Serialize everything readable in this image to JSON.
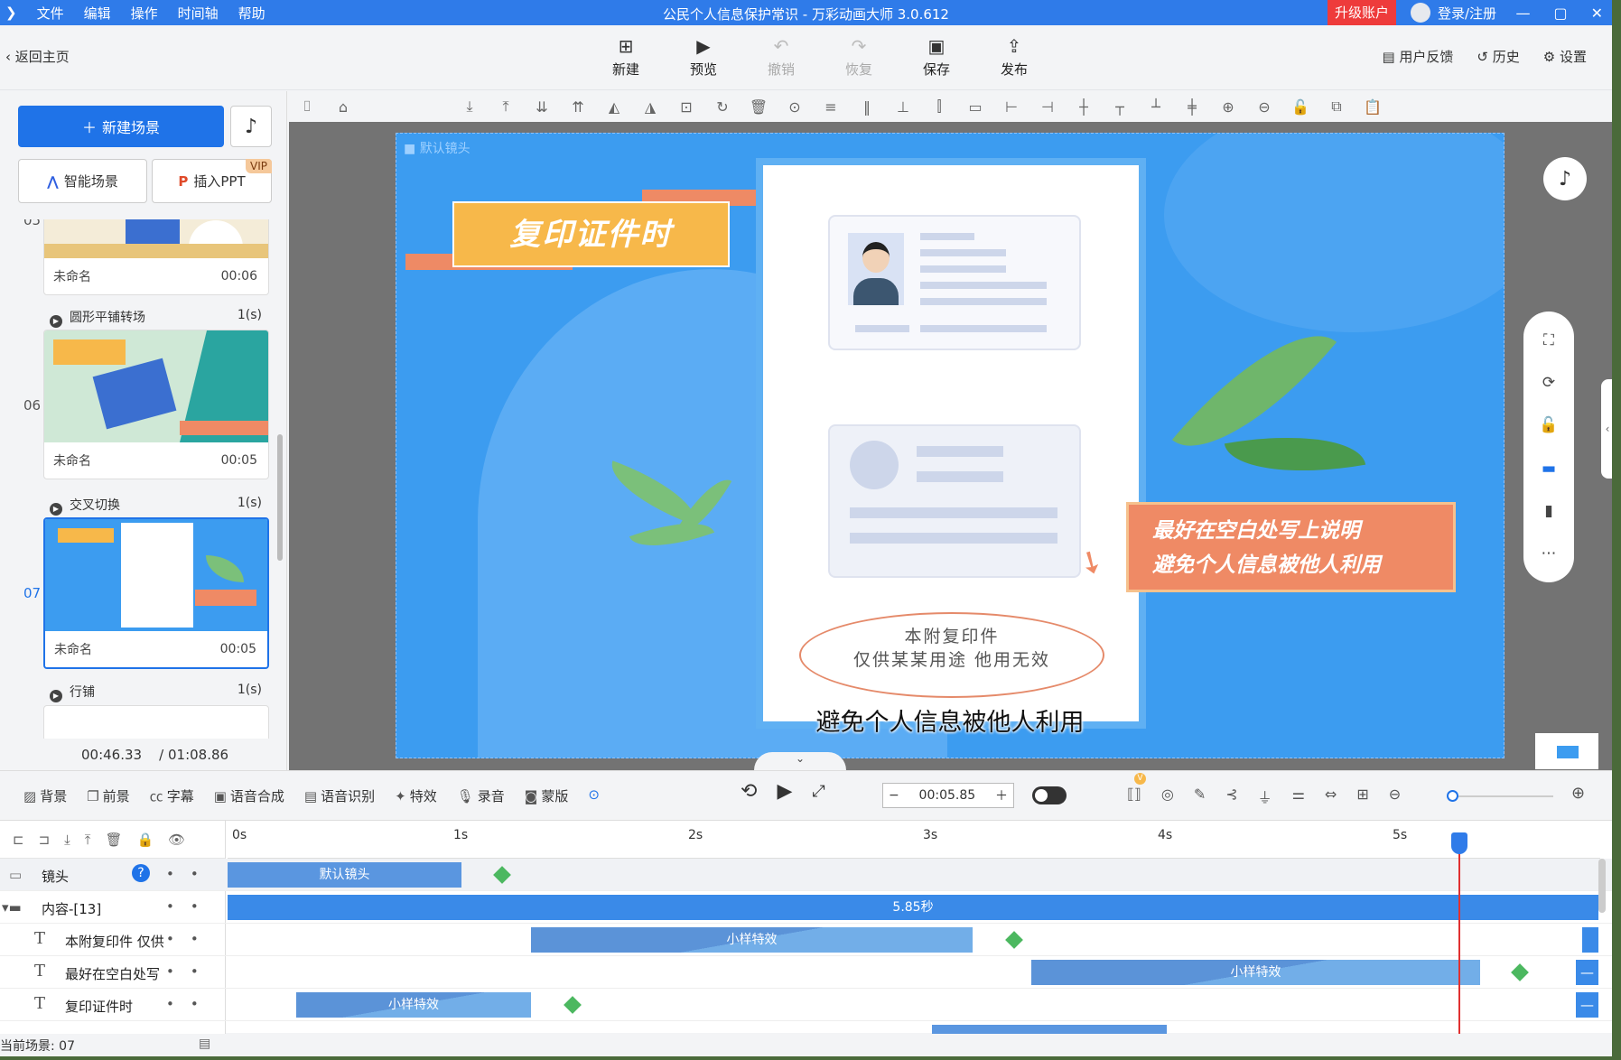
{
  "window": {
    "title": "公民个人信息保护常识 - 万彩动画大师 3.0.612",
    "menu": [
      "文件",
      "编辑",
      "操作",
      "时间轴",
      "帮助"
    ],
    "upgrade": "升级账户",
    "login": "登录/注册"
  },
  "toolbar": {
    "back": "返回主页",
    "new": "新建",
    "preview": "预览",
    "undo": "撤销",
    "redo": "恢复",
    "save": "保存",
    "publish": "发布",
    "feedback": "用户反馈",
    "history": "历史",
    "settings": "设置"
  },
  "left": {
    "new_scene": "新建场景",
    "smart_scene": "智能场景",
    "insert_ppt": "插入PPT",
    "vip": "VIP",
    "scenes": [
      {
        "num": "05",
        "name": "未命名",
        "duration": "00:06",
        "transition": "圆形平铺转场",
        "trans_time": "1(s)"
      },
      {
        "num": "06",
        "name": "未命名",
        "duration": "00:05",
        "transition": "交叉切换",
        "trans_time": "1(s)"
      },
      {
        "num": "07",
        "name": "未命名",
        "duration": "00:05",
        "transition": "行铺",
        "trans_time": "1(s)"
      }
    ],
    "current_time": "00:46.33",
    "total_time": "/ 01:08.86"
  },
  "stage": {
    "camera_label": "默认镜头",
    "banner": "复印证件时",
    "stamp_line1": "本附复印件",
    "stamp_line2": "仅供某某用途  他用无效",
    "callout_line1": "最好在空白处写上说明",
    "callout_line2": "避免个人信息被他人利用",
    "subtitle": "避免个人信息被他人利用"
  },
  "timeline_toolbar": {
    "items": [
      "背景",
      "前景",
      "字幕",
      "语音合成",
      "语音识别",
      "特效",
      "录音",
      "蒙版"
    ],
    "time": "00:05.85",
    "v_badge": "V"
  },
  "timeline": {
    "ticks": [
      "0s",
      "1s",
      "2s",
      "3s",
      "4s",
      "5s"
    ],
    "tracks": [
      {
        "label": "镜头",
        "clip": "默认镜头"
      },
      {
        "label": "内容-[13]",
        "clip": "5.85秒"
      },
      {
        "label": "本附复印件 仅供",
        "clip": "小样特效"
      },
      {
        "label": "最好在空白处写",
        "clip": "小样特效"
      },
      {
        "label": "复印证件时",
        "clip": "小样特效"
      }
    ],
    "help": "?"
  },
  "status": {
    "current_scene": "当前场景: 07"
  },
  "colors": {
    "accent": "#1f73e8",
    "titlebar": "#2f7be9",
    "slide_bg": "#3c9cf0",
    "banner": "#f7b84a",
    "callout": "#ef8a65",
    "keyframe": "#4cb860",
    "playhead": "#e03030"
  }
}
